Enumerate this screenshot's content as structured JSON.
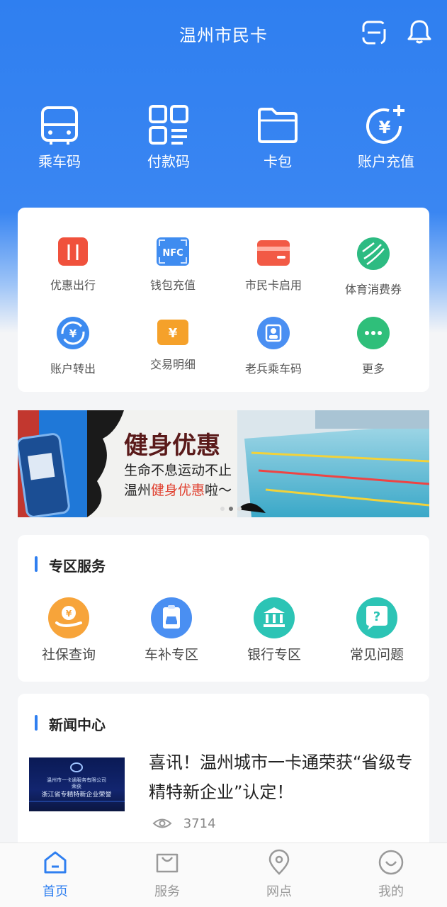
{
  "header": {
    "title": "温州市民卡",
    "icons": [
      "scan-icon",
      "bell-icon"
    ]
  },
  "quick_actions": [
    {
      "label": "乘车码",
      "icon": "bus-icon"
    },
    {
      "label": "付款码",
      "icon": "qr-code-icon"
    },
    {
      "label": "卡包",
      "icon": "folder-icon"
    },
    {
      "label": "账户充值",
      "icon": "recharge-icon"
    }
  ],
  "services": [
    {
      "label": "优惠出行",
      "icon": "suitcase-icon",
      "color": "#f0513c"
    },
    {
      "label": "钱包充值",
      "icon": "nfc-icon",
      "color": "#3f8cf0"
    },
    {
      "label": "市民卡启用",
      "icon": "card-icon",
      "color": "#f25a45"
    },
    {
      "label": "体育消费券",
      "icon": "ball-icon",
      "color": "#2dbb82"
    },
    {
      "label": "账户转出",
      "icon": "transfer-icon",
      "color": "#3d8bf0"
    },
    {
      "label": "交易明细",
      "icon": "ticket-icon",
      "color": "#f5a12a"
    },
    {
      "label": "老兵乘车码",
      "icon": "veteran-icon",
      "color": "#4a8ff2"
    },
    {
      "label": "更多",
      "icon": "more-icon",
      "color": "#2fbf7a"
    }
  ],
  "banner": {
    "headline": "健身优惠",
    "line1": "生命不息运动不止",
    "line2_prefix": "温州",
    "line2_highlight": "健身优惠",
    "line2_suffix": "啦～",
    "dots": 3,
    "active_dot": 1
  },
  "zone": {
    "title": "专区服务",
    "items": [
      {
        "label": "社保查询",
        "icon": "social-security-icon",
        "color": "#f7a43a"
      },
      {
        "label": "车补专区",
        "icon": "car-subsidy-icon",
        "color": "#4a8ff2"
      },
      {
        "label": "银行专区",
        "icon": "bank-icon",
        "color": "#2cc4b5"
      },
      {
        "label": "常见问题",
        "icon": "question-icon",
        "color": "#2cc4b5"
      }
    ]
  },
  "news": {
    "title": "新闻中心",
    "item": {
      "headline": "喜讯！温州城市一卡通荣获“省级专精特新企业”认定！",
      "views": "3714",
      "thumb_line1": "温州市一卡通服务有限公司",
      "thumb_line2": "荣获",
      "thumb_line3": "浙江省专精特新企业荣誉"
    }
  },
  "tabbar": [
    {
      "label": "首页",
      "icon": "home-icon",
      "active": true
    },
    {
      "label": "服务",
      "icon": "bag-icon",
      "active": false
    },
    {
      "label": "网点",
      "icon": "location-icon",
      "active": false
    },
    {
      "label": "我的",
      "icon": "smile-icon",
      "active": false
    }
  ],
  "colors": {
    "primary": "#2f7ff0",
    "background": "#f4f5f7"
  }
}
